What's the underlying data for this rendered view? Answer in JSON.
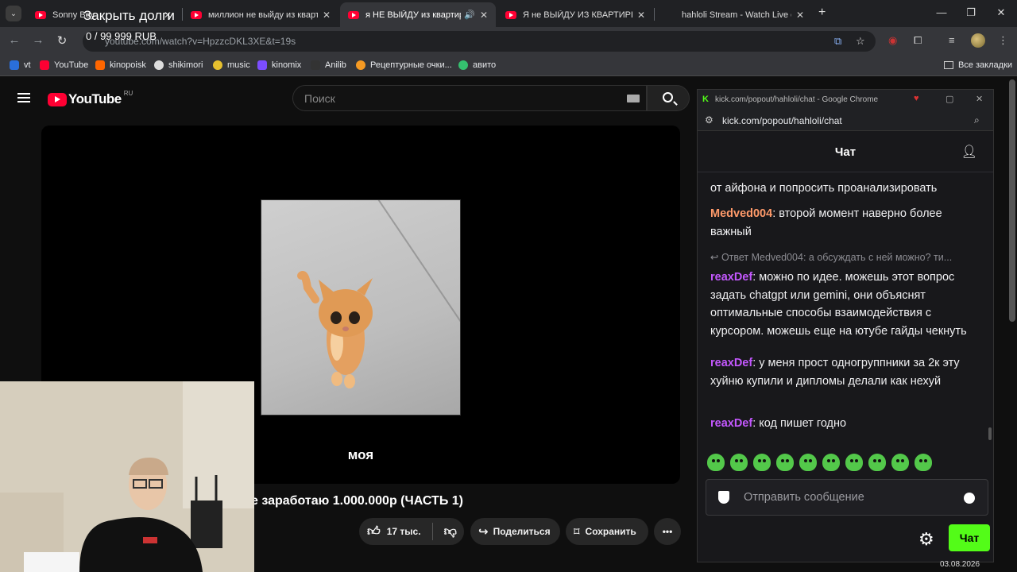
{
  "browser": {
    "tabs": [
      {
        "title": "Sonny Boy",
        "icon": "youtube-icon"
      },
      {
        "title": "миллион не выйду из квартир",
        "icon": "youtube-icon"
      },
      {
        "title": "я НЕ ВЫЙДУ из квартиры,",
        "icon": "youtube-icon",
        "active": true
      },
      {
        "title": "Я не ВЫЙДУ ИЗ КВАРТИРЫ, п",
        "icon": "youtube-icon"
      },
      {
        "title": "hahloli Stream - Watch Live on",
        "icon": "kick-icon"
      }
    ],
    "url": "youtube.com/watch?v=HpzzcDKL3XE&t=19s",
    "overlay_title": "Закрыть долги",
    "overlay_amount": "0 / 99 999 RUB",
    "bookmarks": [
      "vt",
      "YouTube",
      "kinopoisk",
      "shikimori",
      "music",
      "kinomix",
      "Anilib",
      "Рецептурные очки...",
      "авито"
    ],
    "all_bookmarks": "Все закладки"
  },
  "youtube": {
    "logo_text": "YouTube",
    "region": "RU",
    "search_placeholder": "Поиск",
    "video_caption": "моя",
    "video_title": "е заработаю 1.000.000р (ЧАСТЬ 1)",
    "likes": "17 тыс.",
    "share_label": "Поделиться",
    "save_label": "Сохранить"
  },
  "kick": {
    "window_title": "kick.com/popout/hahloli/chat - Google Chrome",
    "url": "kick.com/popout/hahloli/chat",
    "header": "Чат",
    "messages": [
      {
        "user": "",
        "text": "от айфона и попросить проанализировать",
        "color": "#efeff1"
      },
      {
        "user": "Medved004",
        "text": "второй момент наверно более важный",
        "color": "#ff9a6a"
      },
      {
        "user": "reaxDef",
        "text": "можно по идее. можешь этот вопрос задать chatgpt или gemini, они объяснят оптимальные способы взаимодействия с курсором. можешь еще на ютубе гайды чекнуть",
        "color": "#c458ff"
      },
      {
        "user": "reaxDef",
        "text": "у меня прост одногруппники за 2к эту хуйню купили и дипломы делали как нехуй",
        "color": "#c458ff"
      },
      {
        "user": "reaxDef",
        "text": "код пишет годно",
        "color": "#c458ff"
      }
    ],
    "reply_to": "Ответ Medved004: а обсуждать с ней можно? ти...",
    "input_placeholder": "Отправить сообщение",
    "send_label": "Чат"
  },
  "taskbar": {
    "date": "03.08.2026"
  }
}
